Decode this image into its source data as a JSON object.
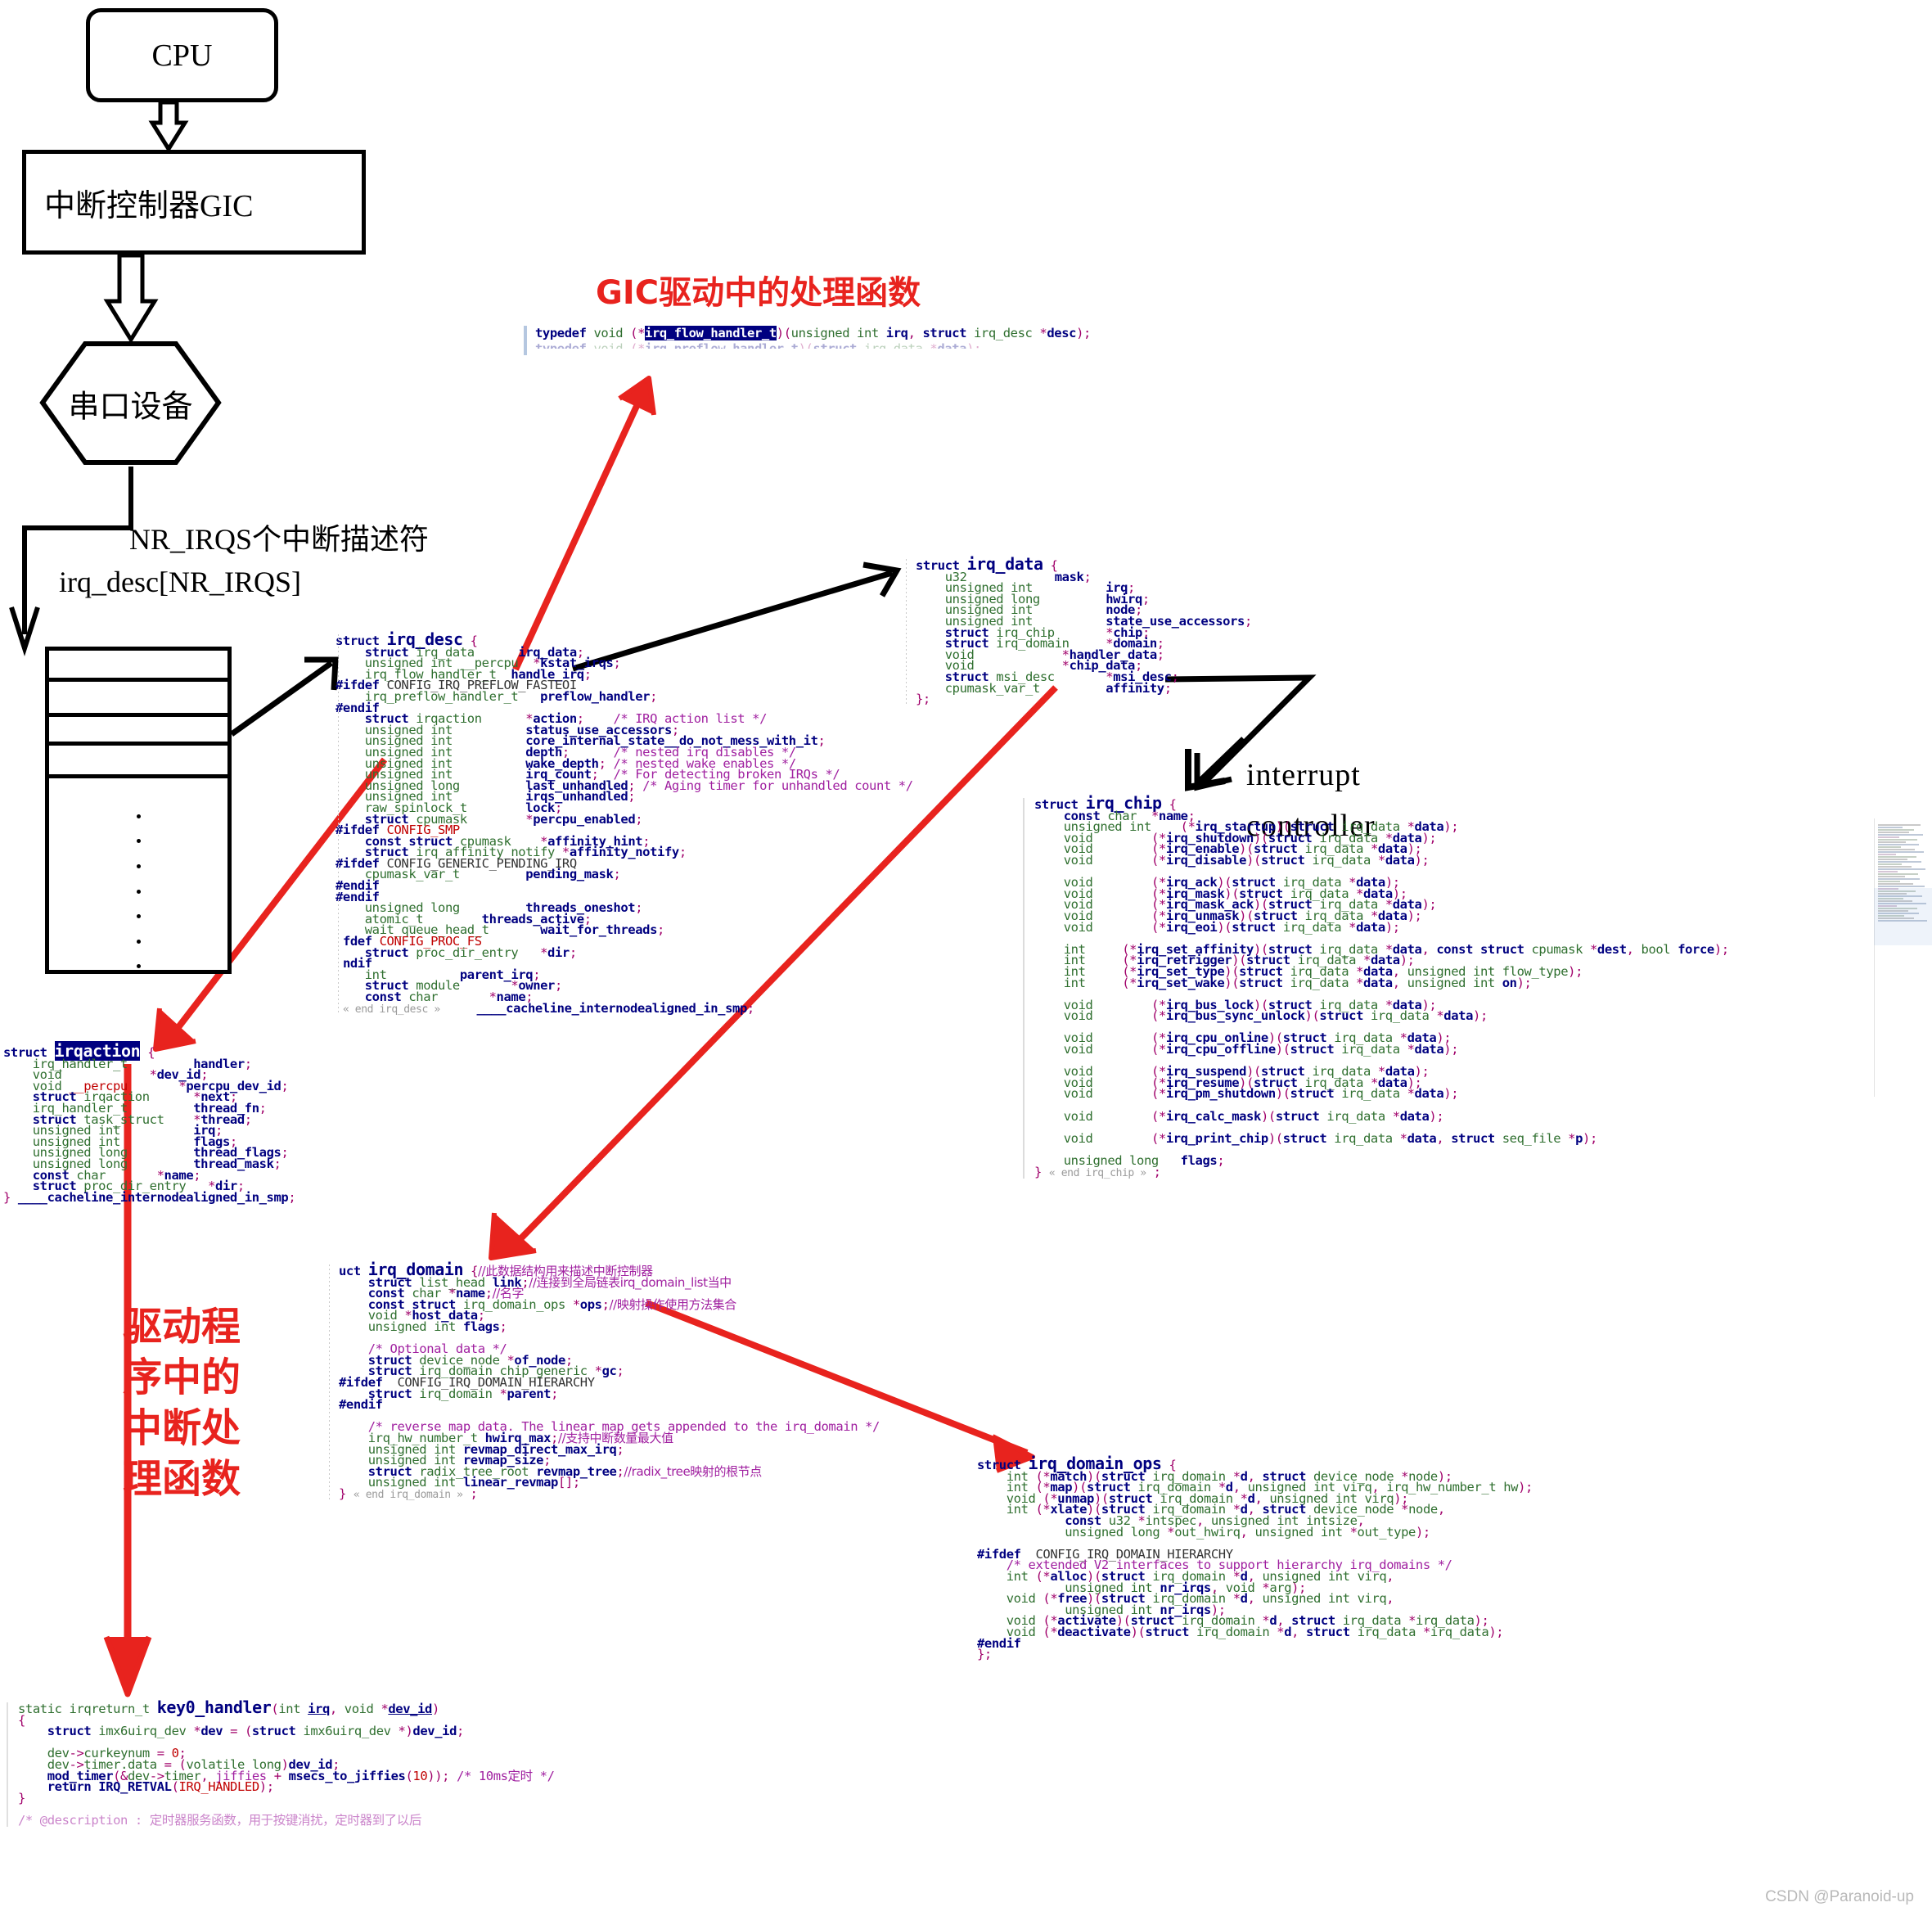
{
  "flow": {
    "cpu": "CPU",
    "gic": "中断控制器GIC",
    "serial": "串口设备",
    "array_caption_1": "NR_IRQS个中断描述符",
    "array_caption_2": "irq_desc[NR_IRQS]"
  },
  "annotations": {
    "gic_handler_title": "GIC驱动中的处理函数",
    "interrupt": "interrupt",
    "controller": "controller",
    "driver_handler_vertical": "驱动程序中的中断处理函数",
    "driver_handler_lines": [
      "驱动程",
      "序中的",
      "中断处",
      "理函数"
    ]
  },
  "colors": {
    "red": "#e8231e",
    "navy": "#000080",
    "type_green": "#2f6f2f",
    "comment_purple": "#a020a0",
    "selection_bg": "#000080",
    "preproc_red": "#c00000"
  },
  "code": {
    "typedef_block": {
      "title": "irq_flow_handler_t",
      "lines": [
        "typedef void (*irq_flow_handler_t)(unsigned int irq, struct irq_desc *desc);"
      ]
    },
    "irq_desc": {
      "name": "irq_desc",
      "lines": [
        "struct irq_desc {",
        "    struct irq_data       irq_data;",
        "    unsigned int __percpu  *kstat_irqs;",
        "    irq_flow_handler_t  handle_irq;",
        "#ifdef CONFIG_IRQ_PREFLOW_FASTEOI",
        "    irq_preflow_handler_t   preflow_handler;",
        "#endif",
        "    struct irqaction      *action;    /* IRQ action list */",
        "    unsigned int          status_use_accessors;",
        "    unsigned int          core_internal_state__do_not_mess_with_it;",
        "    unsigned int          depth;      /* nested irq disables */",
        "    unsigned int          wake_depth; /* nested wake enables */",
        "    unsigned int          irq_count;  /* For detecting broken IRQs */",
        "    unsigned long         last_unhandled; /* Aging timer for unhandled count */",
        "    unsigned int          irqs_unhandled;",
        "    raw_spinlock_t        lock;",
        "    struct cpumask        *percpu_enabled;",
        "#ifdef CONFIG_SMP",
        "    const struct cpumask    *affinity_hint;",
        "    struct irq_affinity_notify *affinity_notify;",
        "#ifdef CONFIG_GENERIC_PENDING_IRQ",
        "    cpumask_var_t         pending_mask;",
        "#endif",
        "#endif",
        "    unsigned long         threads_oneshot;",
        "    atomic_t        threads_active;",
        "    wait_queue_head_t       wait_for_threads;",
        "fdef CONFIG_PROC_FS",
        "    struct proc_dir_entry   *dir;",
        "ndif",
        "    int          parent_irq;",
        "    struct module       *owner;",
        "    const char        *name;",
        "« end irq_desc »      ____cacheline_internodealigned_in_smp;"
      ]
    },
    "irq_data": {
      "name": "irq_data",
      "lines": [
        "struct irq_data {",
        "    u32            mask;",
        "    unsigned int          irq;",
        "    unsigned long         hwirq;",
        "    unsigned int          node;",
        "    unsigned int          state_use_accessors;",
        "    struct irq_chip       *chip;",
        "    struct irq_domain     *domain;",
        "    void            *handler_data;",
        "    void            *chip_data;",
        "    struct msi_desc       *msi_desc;",
        "    cpumask_var_t         affinity;",
        "};"
      ]
    },
    "irq_chip": {
      "name": "irq_chip",
      "lines": [
        "struct irq_chip {",
        "    const char  *name;",
        "    unsigned int    (*irq_startup)(struct irq_data *data);",
        "    void        (*irq_shutdown)(struct irq_data *data);",
        "    void        (*irq_enable)(struct irq_data *data);",
        "    void        (*irq_disable)(struct irq_data *data);",
        "",
        "    void        (*irq_ack)(struct irq_data *data);",
        "    void        (*irq_mask)(struct irq_data *data);",
        "    void        (*irq_mask_ack)(struct irq_data *data);",
        "    void        (*irq_unmask)(struct irq_data *data);",
        "    void        (*irq_eoi)(struct irq_data *data);",
        "",
        "    int     (*irq_set_affinity)(struct irq_data *data, const struct cpumask *dest, bool force);",
        "    int     (*irq_retrigger)(struct irq_data *data);",
        "    int     (*irq_set_type)(struct irq_data *data, unsigned int flow_type);",
        "    int     (*irq_set_wake)(struct irq_data *data, unsigned int on);",
        "",
        "    void        (*irq_bus_lock)(struct irq_data *data);",
        "    void        (*irq_bus_sync_unlock)(struct irq_data *data);",
        "",
        "    void        (*irq_cpu_online)(struct irq_data *data);",
        "    void        (*irq_cpu_offline)(struct irq_data *data);",
        "",
        "    void        (*irq_suspend)(struct irq_data *data);",
        "    void        (*irq_resume)(struct irq_data *data);",
        "    void        (*irq_pm_shutdown)(struct irq_data *data);",
        "",
        "    void        (*irq_calc_mask)(struct irq_data *data);",
        "",
        "    void        (*irq_print_chip)(struct irq_data *data, struct seq_file *p);",
        "",
        "    unsigned long   flags;",
        "} « end irq_chip » ;"
      ]
    },
    "irqaction": {
      "name": "irqaction",
      "lines": [
        "struct irqaction {",
        "    irq_handler_t         handler;",
        "    void            *dev_id;",
        "    void __percpu       *percpu_dev_id;",
        "    struct irqaction      *next;",
        "    irq_handler_t         thread_fn;",
        "    struct task_struct    *thread;",
        "    unsigned int          irq;",
        "    unsigned int          flags;",
        "    unsigned long         thread_flags;",
        "    unsigned long         thread_mask;",
        "    const char        *name;",
        "    struct proc_dir_entry   *dir;",
        "} ____cacheline_internodealigned_in_smp;"
      ]
    },
    "irq_domain": {
      "name": "irq_domain",
      "lines": [
        "uct irq_domain {//此数据结构用来描述中断控制器",
        "    struct list_head link;//连接到全局链表irq_domain_list当中",
        "    const char *name;//名字",
        "    const struct irq_domain_ops *ops;//映射操作使用方法集合",
        "    void *host_data;",
        "    unsigned int flags;",
        "",
        "    /* Optional data */",
        "    struct device_node *of_node;",
        "    struct irq_domain_chip_generic *gc;",
        "#ifdef  CONFIG_IRQ_DOMAIN_HIERARCHY",
        "    struct irq_domain *parent;",
        "#endif",
        "",
        "    /* reverse map data. The linear map gets appended to the irq_domain */",
        "    irq_hw_number_t hwirq_max;//支持中断数量最大值",
        "    unsigned int revmap_direct_max_irq;",
        "    unsigned int revmap_size;",
        "    struct radix_tree_root revmap_tree;//radix_tree映射的根节点",
        "    unsigned int linear_revmap[];",
        "} « end irq_domain » ;"
      ]
    },
    "irq_domain_ops": {
      "name": "irq_domain_ops",
      "lines": [
        "struct irq_domain_ops {",
        "    int (*match)(struct irq_domain *d, struct device_node *node);",
        "    int (*map)(struct irq_domain *d, unsigned int virq, irq_hw_number_t hw);",
        "    void (*unmap)(struct irq_domain *d, unsigned int virq);",
        "    int (*xlate)(struct irq_domain *d, struct device_node *node,",
        "            const u32 *intspec, unsigned int intsize,",
        "            unsigned long *out_hwirq, unsigned int *out_type);",
        "",
        "#ifdef  CONFIG_IRQ_DOMAIN_HIERARCHY",
        "    /* extended V2 interfaces to support hierarchy irq_domains */",
        "    int (*alloc)(struct irq_domain *d, unsigned int virq,",
        "            unsigned int nr_irqs, void *arg);",
        "    void (*free)(struct irq_domain *d, unsigned int virq,",
        "            unsigned int nr_irqs);",
        "    void (*activate)(struct irq_domain *d, struct irq_data *irq_data);",
        "    void (*deactivate)(struct irq_domain *d, struct irq_data *irq_data);",
        "#endif",
        "};"
      ]
    },
    "key0_handler": {
      "name": "key0_handler",
      "lines": [
        "static irqreturn_t key0_handler(int irq, void *dev_id)",
        "{",
        "    struct imx6uirq_dev *dev = (struct imx6uirq_dev *)dev_id;",
        "",
        "    dev->curkeynum = 0;",
        "    dev->timer.data = (volatile long)dev_id;",
        "    mod_timer(&dev->timer, jiffies + msecs_to_jiffies(10)); /* 10ms定时 */",
        "    return IRQ_RETVAL(IRQ_HANDLED);",
        "}",
        "",
        "/* @description : 定时器服务函数，用于按键消扰，定时器到了以后"
      ]
    }
  },
  "watermark": "CSDN @Paranoid-up"
}
